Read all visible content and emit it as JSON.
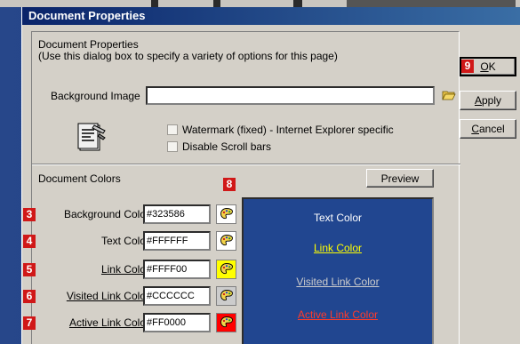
{
  "window": {
    "title": "Document Properties"
  },
  "header": {
    "line1": "Document Properties",
    "line2": "(Use this dialog box to specify a variety of options for this page)"
  },
  "background_image": {
    "label": "Background Image",
    "value": "",
    "browse_icon": "folder-open-icon"
  },
  "options": {
    "watermark": {
      "label": "Watermark (fixed) - Internet Explorer specific",
      "checked": false
    },
    "disable_scroll": {
      "label": "Disable Scroll bars",
      "checked": false
    }
  },
  "colors_section": {
    "label": "Document Colors",
    "preview_button": "Preview"
  },
  "color_rows": [
    {
      "badge": "3",
      "label": "Background Color",
      "value": "#323586",
      "swatch": "#ffffff"
    },
    {
      "badge": "4",
      "label": "Text Color",
      "value": "#FFFFFF",
      "swatch": "#ffffff"
    },
    {
      "badge": "5",
      "label": "Link Color",
      "value": "#FFFF00",
      "swatch": "#ffff00"
    },
    {
      "badge": "6",
      "label": "Visited Link Color",
      "value": "#CCCCCC",
      "swatch": "#cccccc"
    },
    {
      "badge": "7",
      "label": "Active Link Color",
      "value": "#FF0000",
      "swatch": "#ff0000"
    }
  ],
  "callouts": {
    "palette": "8",
    "ok": "9"
  },
  "preview": {
    "background": "#214690",
    "text": {
      "label": "Text Color",
      "color": "#ffffff"
    },
    "link": {
      "label": "Link Color",
      "color": "#ffff00"
    },
    "visited": {
      "label": "Visited Link Color",
      "color": "#cccccc"
    },
    "active": {
      "label": "Active Link Color",
      "color": "#ff3b2a"
    }
  },
  "buttons": {
    "ok": {
      "mnemonic": "O",
      "rest": "K"
    },
    "apply": {
      "mnemonic": "A",
      "rest": "pply"
    },
    "cancel": {
      "mnemonic": "C",
      "rest": "ancel"
    }
  },
  "colors": {
    "title_bar_start": "#0a246a",
    "title_bar_end": "#3a6ea5",
    "dialog_face": "#d4d0c8",
    "callout_badge": "#d01818"
  }
}
